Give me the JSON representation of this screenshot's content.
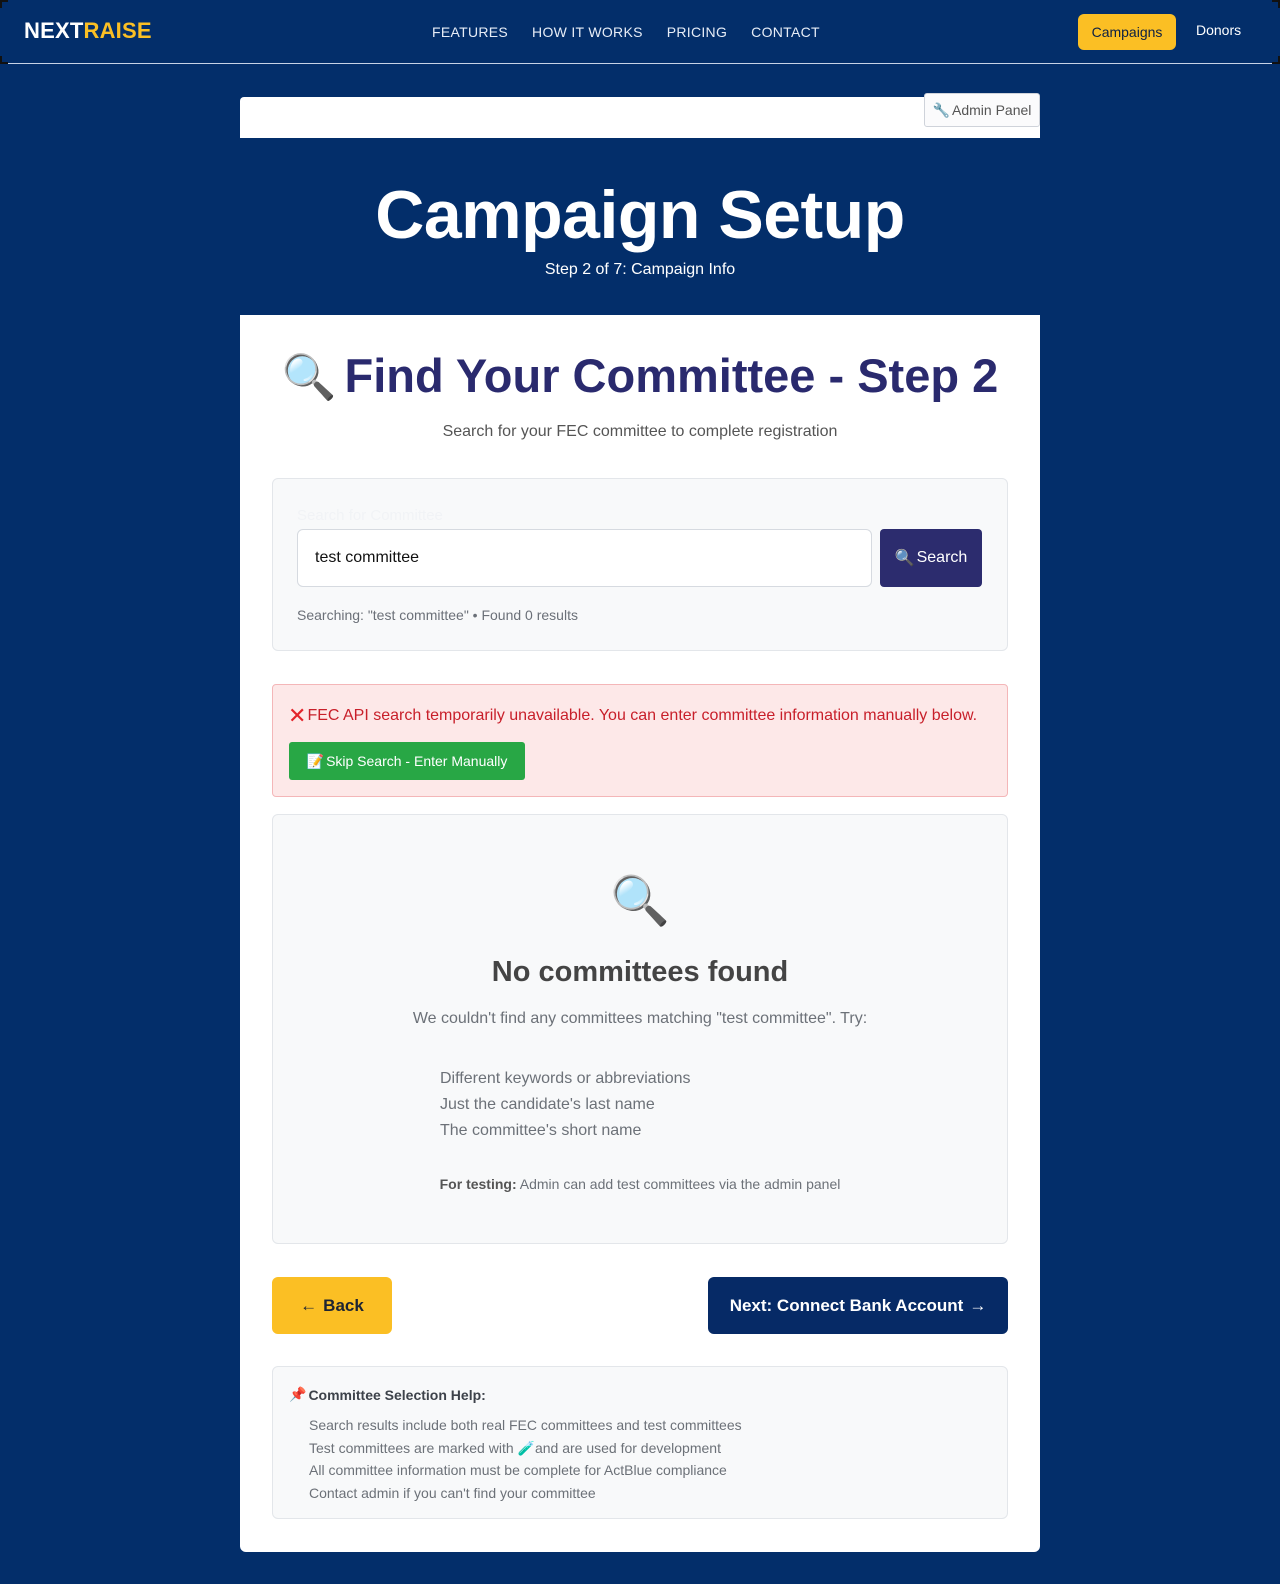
{
  "nav": {
    "logo_part1": "NEXT",
    "logo_part2": "RAISE",
    "links": [
      "FEATURES",
      "HOW IT WORKS",
      "PRICING",
      "CONTACT"
    ],
    "campaigns_label": "Campaigns",
    "donors_label": "Donors"
  },
  "admin_panel_label": "Admin Panel",
  "hero": {
    "title": "Campaign Setup",
    "subtitle": "Step 2 of 7: Campaign Info"
  },
  "main": {
    "heading": "Find Your Committee - Step 2",
    "lead": "Search for your FEC committee to complete registration"
  },
  "search": {
    "label": "Search for Committee",
    "input_value": "test committee",
    "button_label": "Search",
    "status": "Searching: \"test committee\" • Found 0 results"
  },
  "alert": {
    "message": "FEC API search temporarily unavailable. You can enter committee information manually below.",
    "skip_label": "Skip Search - Enter Manually"
  },
  "empty": {
    "title": "No committees found",
    "subtitle": "We couldn't find any committees matching \"test committee\". Try:",
    "tips": [
      "Different keywords or abbreviations",
      "Just the candidate's last name",
      "The committee's short name"
    ],
    "testing_label": "For testing:",
    "testing_text": "Admin can add test committees via the admin panel"
  },
  "actions": {
    "back_label": "Back",
    "next_label": "Next: Connect Bank Account"
  },
  "help": {
    "title": "Committee Selection Help:",
    "items": [
      "Search results include both real FEC committees and test committees",
      "Test committees are marked with",
      "and are used for development",
      "All committee information must be complete for ActBlue compliance",
      "Contact admin if you can't find your committee"
    ]
  },
  "colors": {
    "background": "#032e6a",
    "accent": "#fbbf24",
    "heading": "#2a2a6e",
    "alert": "#c81f2a",
    "success": "#28a745"
  },
  "icons": [
    "wrench-icon",
    "magnifier-icon",
    "cross-icon",
    "memo-icon",
    "pushpin-icon",
    "test-tube-icon",
    "arrow-left-icon",
    "arrow-right-icon"
  ]
}
